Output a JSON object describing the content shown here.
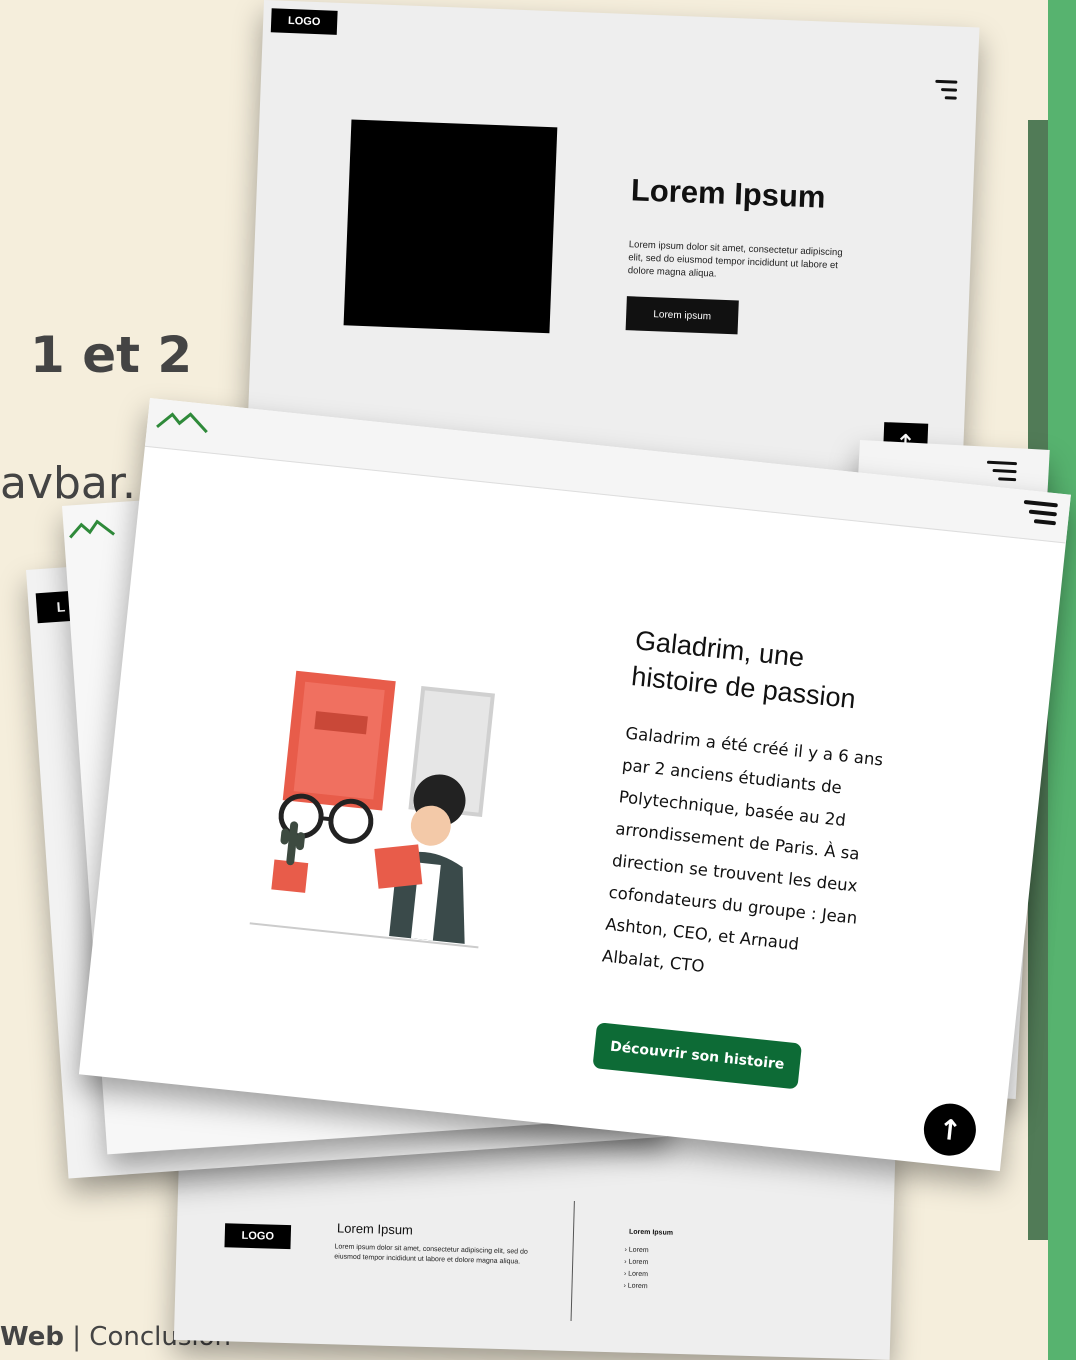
{
  "slide": {
    "heading_fragment": "1 et 2",
    "text_fragment": "avbar.",
    "footer_bold": "Web",
    "footer_separator": " | ",
    "footer_section": "Conclusion"
  },
  "wireframe_top": {
    "logo": "LOGO",
    "title": "Lorem Ipsum",
    "body": "Lorem ipsum dolor sit amet, consectetur adipiscing elit, sed do eiusmod tempor incididunt ut labore et dolore magna aliqua.",
    "button": "Lorem ipsum"
  },
  "wireframe_bottom": {
    "logo": "LOGO",
    "title": "Lorem Ipsum",
    "body": "Lorem ipsum dolor sit amet, consectetur adipiscing elit, sed do eiusmod tempor incididunt ut labore et dolore magna aliqua.",
    "links_title": "Lorem Ipsum",
    "links": [
      "Lorem",
      "Lorem",
      "Lorem",
      "Lorem"
    ]
  },
  "left_card": {
    "logo_fragment": "L"
  },
  "main_card": {
    "title": "Galadrim, une histoire de passion",
    "body": "Galadrim a été créé il y a 6 ans par 2 anciens étudiants de Polytechnique, basée au 2d arrondissement de Paris. À sa direction se trouvent les deux cofondateurs du groupe : Jean Ashton, CEO, et Arnaud Albalat, CTO",
    "button": "Découvrir son histoire"
  },
  "colors": {
    "background": "#f5eedc",
    "accent_green": "#57b36f",
    "button_green": "#0d6b36"
  }
}
